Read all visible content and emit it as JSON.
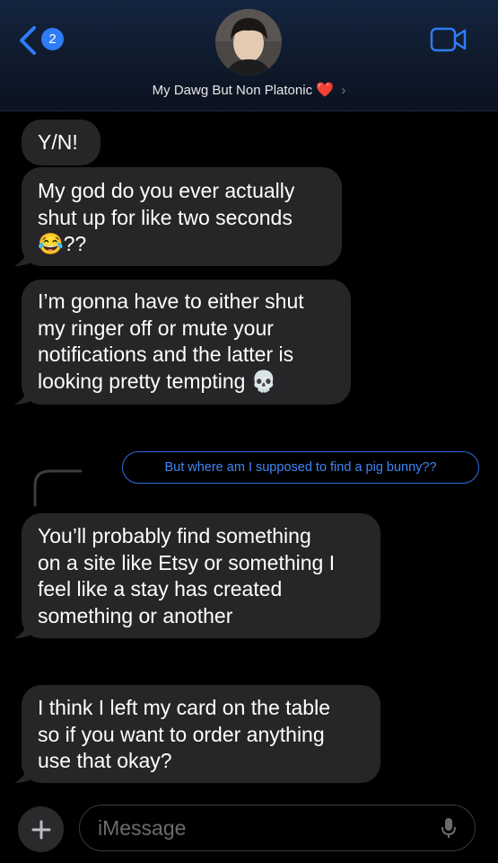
{
  "header": {
    "back_badge": "2",
    "contact_name": "My Dawg But Non Platonic",
    "heart": "❤️",
    "chevron": "›",
    "icons": {
      "back": "chevron-left-icon",
      "video": "video-camera-icon"
    }
  },
  "messages": [
    {
      "text": "Y/N!"
    },
    {
      "text_line1": "My god do you ever actually",
      "text_line2": "shut up for like two seconds",
      "emoji": "😂",
      "text_line3": "??"
    },
    {
      "text_line1": "I’m gonna have to either shut",
      "text_line2": "my ringer off or mute your",
      "text_line3": "notifications and the latter is",
      "text_line4": "looking pretty tempting",
      "emoji": "💀"
    },
    {
      "text_line1": "You’ll probably find something",
      "text_line2": "on a site like Etsy or something I",
      "text_line3": "feel like a stay has created",
      "text_line4": "something or another"
    },
    {
      "text_line1": "I think I left my card on the table",
      "text_line2": "so if you want to order anything",
      "text_line3": "use that okay?"
    }
  ],
  "reply_quote": {
    "text": "But where am I supposed to find a pig bunny??"
  },
  "composer": {
    "plus": "+",
    "placeholder": "iMessage"
  },
  "colors": {
    "bubble": "#262628",
    "accent": "#2f7cf6",
    "background": "#000000"
  }
}
